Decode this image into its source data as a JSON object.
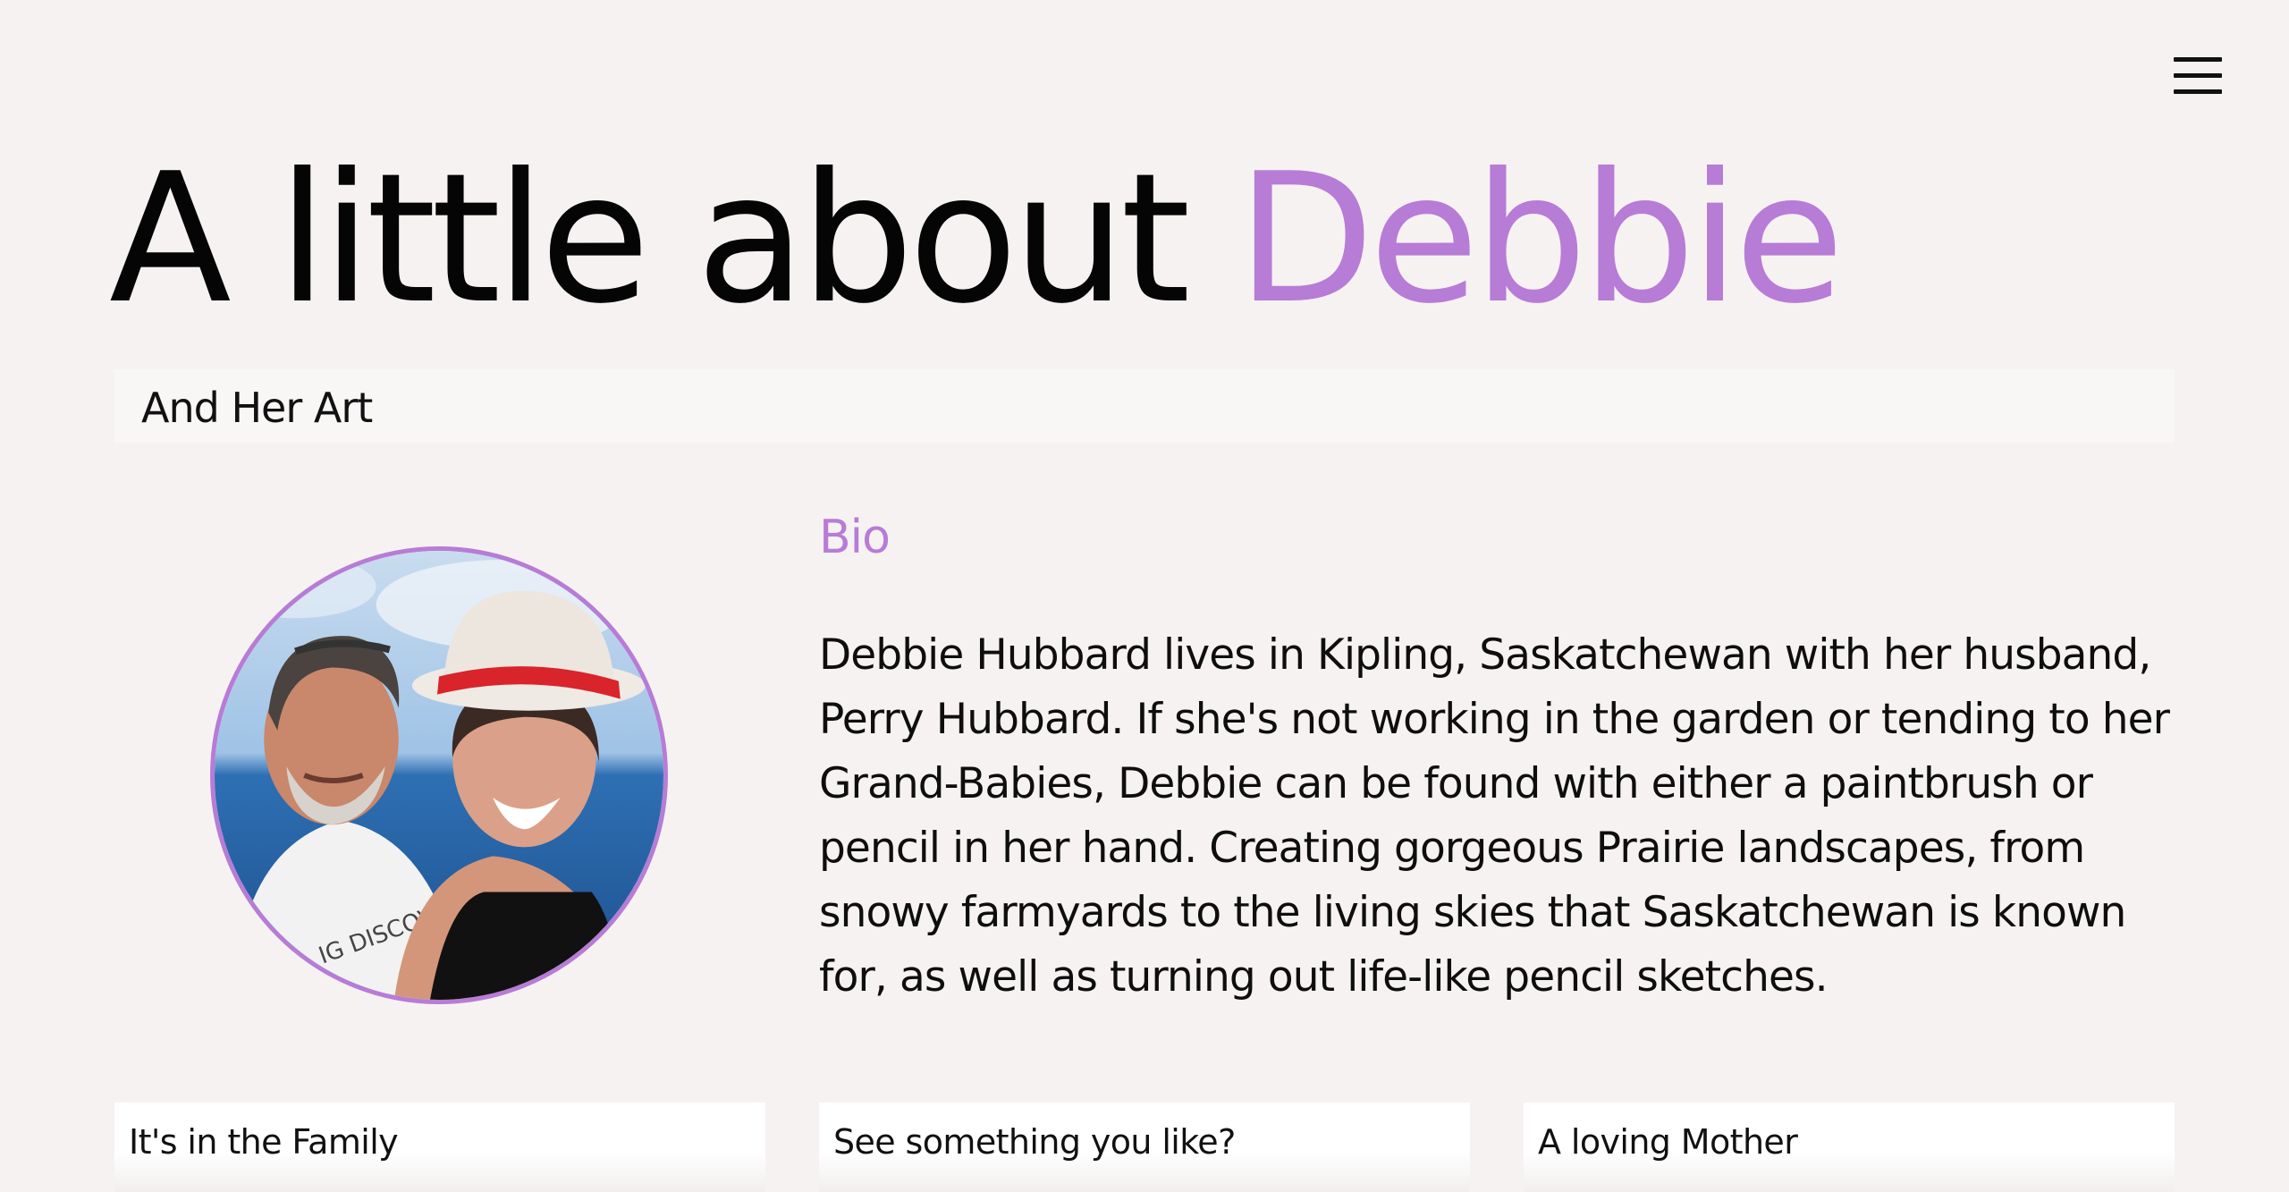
{
  "header": {
    "menu_icon": "hamburger-menu-icon"
  },
  "hero": {
    "title_prefix": "A little about",
    "title_name": "Debbie",
    "accent_color": "#b77cd6"
  },
  "subtitle": {
    "text": "And Her Art"
  },
  "bio": {
    "heading": "Bio",
    "text": "Debbie Hubbard lives in Kipling, Saskatchewan with her husband, Perry Hubbard. If she's not working in the garden or tending to her Grand-Babies, Debbie can be found with either a paintbrush or pencil in her hand. Creating gorgeous Prairie landscapes, from snowy farmyards to the living skies that Saskatchewan is known for, as well as turning out life-like pencil sketches."
  },
  "cards": [
    {
      "title": "It's in the Family"
    },
    {
      "title": "See something you like?"
    },
    {
      "title": "A loving Mother"
    }
  ],
  "colors": {
    "background": "#f7f2f2",
    "accent": "#b77cd6",
    "text": "#0b0b0b"
  }
}
